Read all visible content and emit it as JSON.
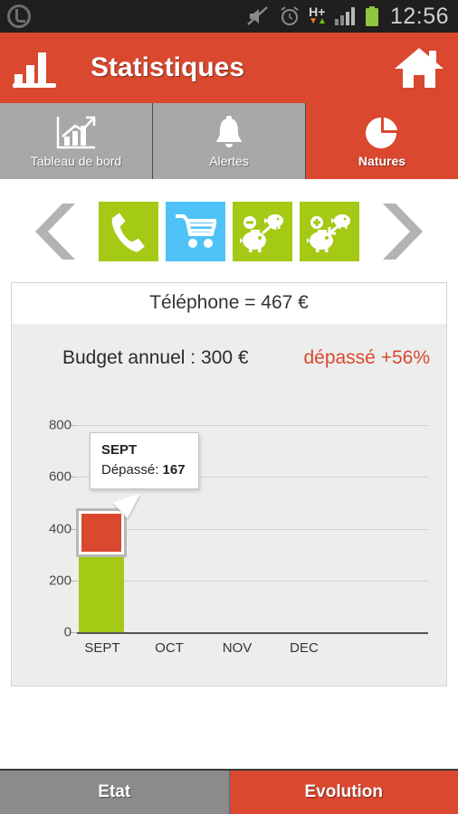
{
  "statusbar": {
    "time": "12:56",
    "network_label": "H+",
    "icons": [
      "app-logo-icon",
      "mute-icon",
      "alarm-icon",
      "hplus-data-icon",
      "signal-icon",
      "battery-icon"
    ]
  },
  "header": {
    "title": "Statistiques",
    "chart_icon": "bar-chart-icon",
    "home_icon": "home-icon"
  },
  "top_tabs": [
    {
      "label": "Tableau de bord",
      "icon": "growth-chart-icon",
      "active": false
    },
    {
      "label": "Alertes",
      "icon": "bell-icon",
      "active": false
    },
    {
      "label": "Natures",
      "icon": "pie-chart-icon",
      "active": true
    }
  ],
  "carousel": {
    "prev_icon": "chevron-left-icon",
    "next_icon": "chevron-right-icon",
    "categories": [
      {
        "name": "telephone",
        "icon": "phone-icon",
        "color": "#a4ca16",
        "selected": true
      },
      {
        "name": "courses",
        "icon": "shopping-cart-icon",
        "color": "#4fc3f7",
        "selected": false
      },
      {
        "name": "depense",
        "icon": "piggy-bank-minus-icon",
        "color": "#a4ca16",
        "selected": false
      },
      {
        "name": "revenu",
        "icon": "piggy-bank-plus-icon",
        "color": "#a4ca16",
        "selected": false
      }
    ]
  },
  "panel": {
    "title": "Téléphone = 467 €",
    "budget_label": "Budget annuel : 300 €",
    "over_label": "dépassé +56%"
  },
  "tooltip": {
    "month": "SEPT",
    "metric_label": "Dépassé:",
    "metric_value": "167"
  },
  "bottom_tabs": [
    {
      "label": "Etat",
      "active": false
    },
    {
      "label": "Evolution",
      "active": true
    }
  ],
  "colors": {
    "brand_red": "#d9482f",
    "bar_green": "#a4ca16",
    "tab_gray": "#a8a8a8",
    "panel_bg": "#ededed",
    "cart_blue": "#4fc3f7"
  },
  "chart_data": {
    "type": "bar",
    "title": "Téléphone = 467 €",
    "xlabel": "",
    "ylabel": "",
    "categories": [
      "SEPT",
      "OCT",
      "NOV",
      "DEC"
    ],
    "ylim": [
      0,
      900
    ],
    "yticks": [
      0,
      200,
      400,
      600,
      800
    ],
    "grid": true,
    "legend": "none",
    "stacked": true,
    "series": [
      {
        "name": "Budget",
        "color": "#a4ca16",
        "values": [
          300,
          0,
          0,
          0
        ]
      },
      {
        "name": "Dépassé",
        "color": "#d9482f",
        "values": [
          167,
          0,
          0,
          0
        ]
      }
    ],
    "annotations": [
      {
        "category": "SEPT",
        "text": "SEPT Dépassé: 167",
        "highlighted_series": "Dépassé"
      }
    ]
  }
}
